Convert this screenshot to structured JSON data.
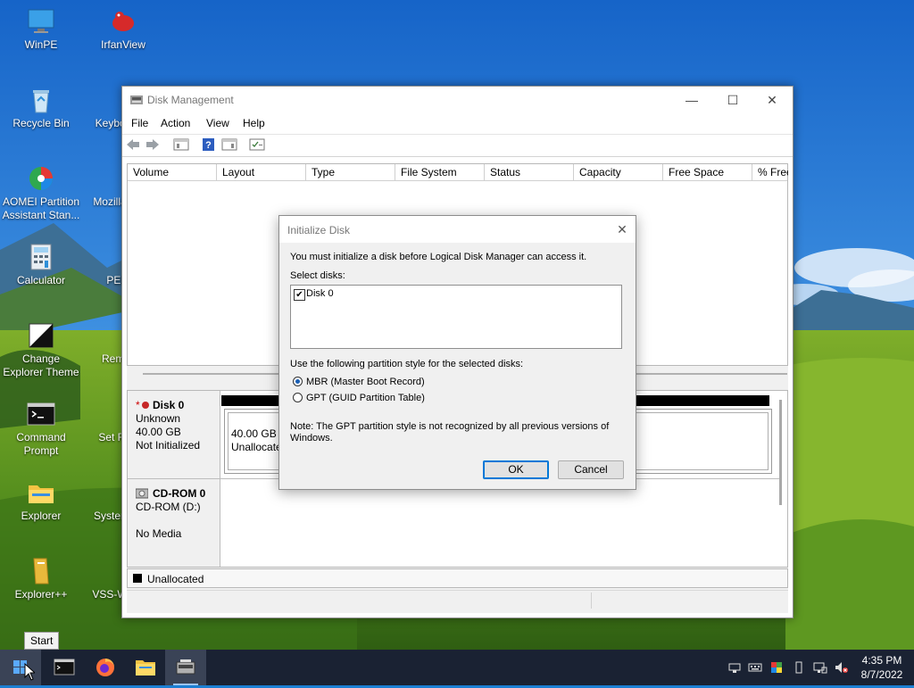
{
  "desktop": {
    "icons": [
      {
        "label": "WinPE"
      },
      {
        "label": "IrfanView"
      },
      {
        "label": "Recycle Bin"
      },
      {
        "label": "Keyboa"
      },
      {
        "label": "AOMEI Partition Assistant Stan..."
      },
      {
        "label": "Mozilla Quant"
      },
      {
        "label": "Calculator"
      },
      {
        "label": "PENe"
      },
      {
        "label": "Change Explorer Theme"
      },
      {
        "label": "Remote"
      },
      {
        "label": "Command Prompt"
      },
      {
        "label": "Set Reso"
      },
      {
        "label": "Explorer"
      },
      {
        "label": "System"
      },
      {
        "label": "Explorer++"
      },
      {
        "label": "VSS-W"
      }
    ]
  },
  "disk_management": {
    "title": "Disk Management",
    "menu": [
      "File",
      "Action",
      "View",
      "Help"
    ],
    "columns": [
      "Volume",
      "Layout",
      "Type",
      "File System",
      "Status",
      "Capacity",
      "Free Space",
      "% Free"
    ],
    "disks": [
      {
        "name": "Disk 0",
        "type": "Unknown",
        "size": "40.00 GB",
        "status": "Not Initialized",
        "partition_size": "40.00 GB",
        "partition_label": "Unallocated"
      },
      {
        "name": "CD-ROM 0",
        "type": "CD-ROM (D:)",
        "status": "No Media"
      }
    ],
    "legend": "Unallocated"
  },
  "init_dialog": {
    "title": "Initialize Disk",
    "intro": "You must initialize a disk before Logical Disk Manager can access it.",
    "select_label": "Select disks:",
    "disk_item": "Disk 0",
    "style_label": "Use the following partition style for the selected disks:",
    "mbr_label": "MBR (Master Boot Record)",
    "gpt_label": "GPT (GUID Partition Table)",
    "note_line1": "Note: The GPT partition style is not recognized by all previous versions of",
    "note_line2": "Windows.",
    "ok": "OK",
    "cancel": "Cancel"
  },
  "taskbar": {
    "start_tooltip": "Start",
    "time": "4:35 PM",
    "date": "8/7/2022"
  }
}
